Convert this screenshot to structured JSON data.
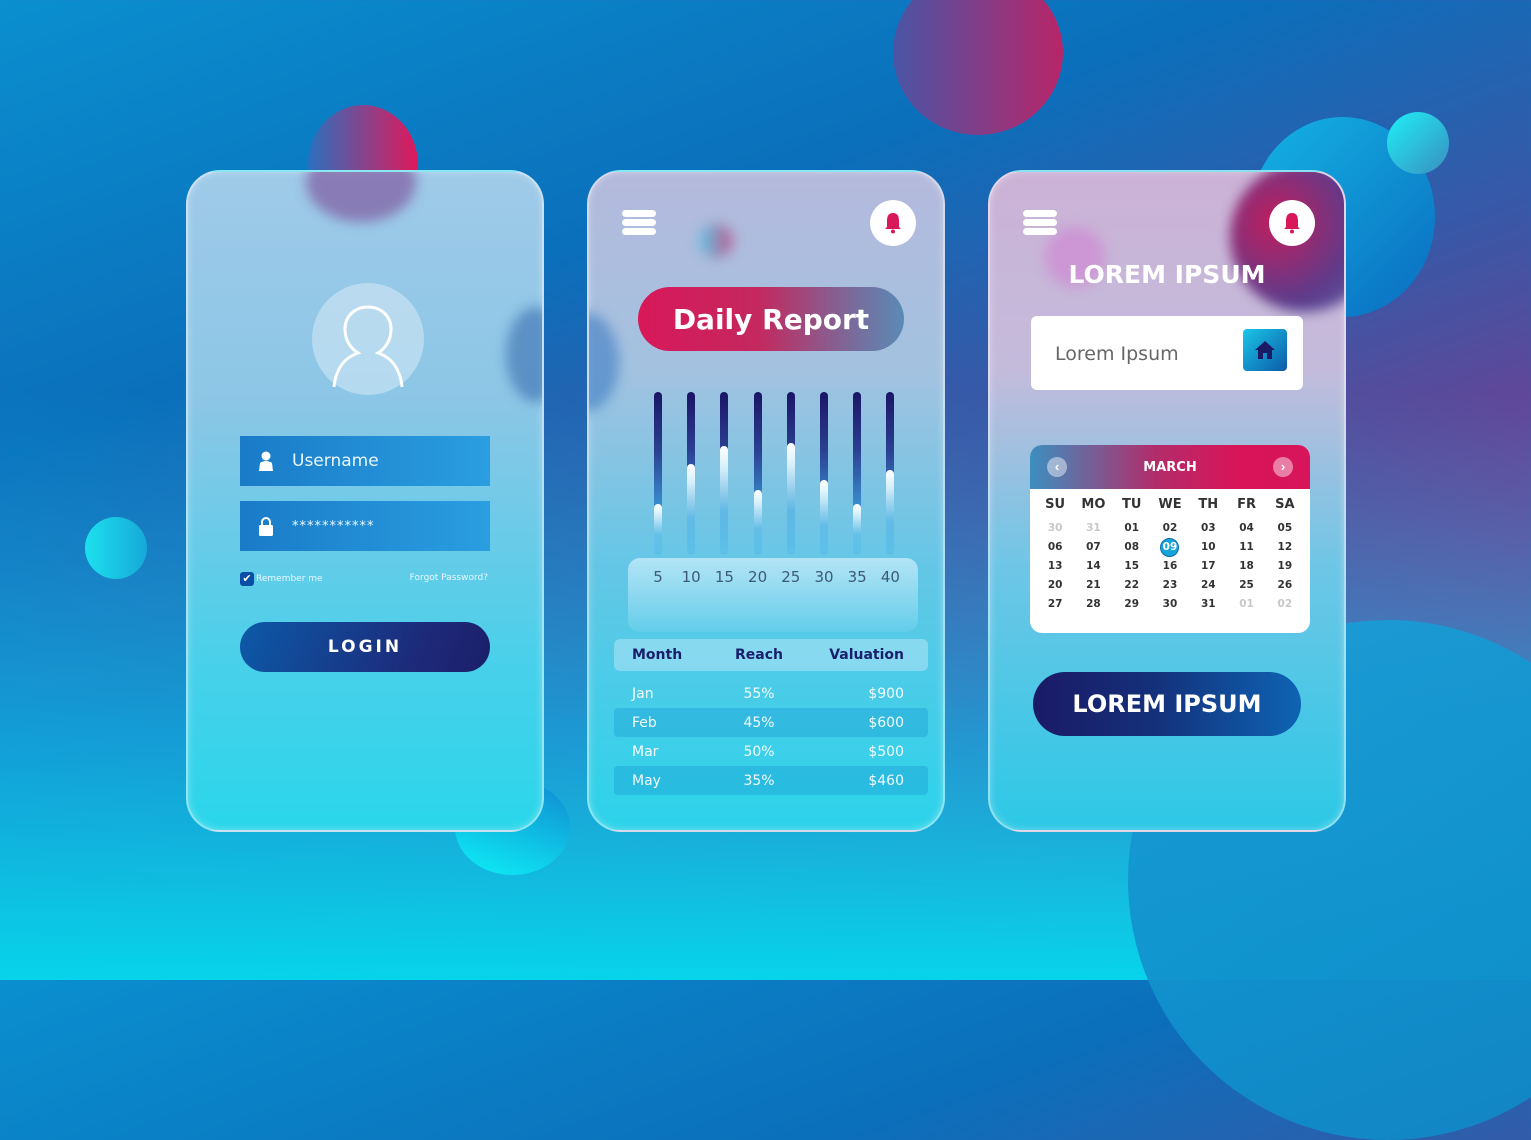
{
  "colors": {
    "accent_pink": "#d8185a",
    "navy": "#1b1a66",
    "cyan": "#17a4d8"
  },
  "login_card": {
    "avatar_icon": "user-outline-icon",
    "username": {
      "icon": "user-icon",
      "placeholder": "Username"
    },
    "password": {
      "icon": "lock-icon",
      "value": "***********"
    },
    "remember_me": {
      "label": "Remember me",
      "checked": true
    },
    "forgot_password": "Forgot Password?",
    "login_button": "LOGIN"
  },
  "report_card": {
    "menu_icon": "hamburger-icon",
    "bell_icon": "bell-icon",
    "title": "Daily Report",
    "chart_data": {
      "type": "bar",
      "title": "Daily Report",
      "categories": [
        "5",
        "10",
        "15",
        "20",
        "25",
        "30",
        "35",
        "40"
      ],
      "values": [
        0.31,
        0.56,
        0.67,
        0.4,
        0.69,
        0.46,
        0.31,
        0.52
      ],
      "ylim": [
        0,
        1
      ],
      "xlabel": "",
      "ylabel": ""
    },
    "table": {
      "headers": [
        "Month",
        "Reach",
        "Valuation"
      ],
      "rows": [
        [
          "Jan",
          "55%",
          "$900"
        ],
        [
          "Feb",
          "45%",
          "$600"
        ],
        [
          "Mar",
          "50%",
          "$500"
        ],
        [
          "May",
          "35%",
          "$460"
        ]
      ]
    }
  },
  "calendar_card": {
    "menu_icon": "hamburger-icon",
    "bell_icon": "bell-icon",
    "title": "LOREM IPSUM",
    "search": {
      "value": "Lorem Ipsum",
      "button_icon": "home-icon"
    },
    "calendar": {
      "month": "MARCH",
      "prev": "‹",
      "next": "›",
      "weekdays": [
        "SU",
        "MO",
        "TU",
        "WE",
        "TH",
        "FR",
        "SA"
      ],
      "days": [
        {
          "d": "30",
          "muted": true
        },
        {
          "d": "31",
          "muted": true
        },
        {
          "d": "01"
        },
        {
          "d": "02"
        },
        {
          "d": "03"
        },
        {
          "d": "04"
        },
        {
          "d": "05"
        },
        {
          "d": "06"
        },
        {
          "d": "07"
        },
        {
          "d": "08"
        },
        {
          "d": "09",
          "selected": true
        },
        {
          "d": "10"
        },
        {
          "d": "11"
        },
        {
          "d": "12"
        },
        {
          "d": "13"
        },
        {
          "d": "14"
        },
        {
          "d": "15"
        },
        {
          "d": "16"
        },
        {
          "d": "17"
        },
        {
          "d": "18"
        },
        {
          "d": "19"
        },
        {
          "d": "20"
        },
        {
          "d": "21"
        },
        {
          "d": "22"
        },
        {
          "d": "23"
        },
        {
          "d": "24"
        },
        {
          "d": "25"
        },
        {
          "d": "26"
        },
        {
          "d": "27"
        },
        {
          "d": "28"
        },
        {
          "d": "29"
        },
        {
          "d": "30"
        },
        {
          "d": "31"
        },
        {
          "d": "01",
          "muted": true
        },
        {
          "d": "02",
          "muted": true
        }
      ]
    },
    "cta_button": "LOREM IPSUM"
  }
}
